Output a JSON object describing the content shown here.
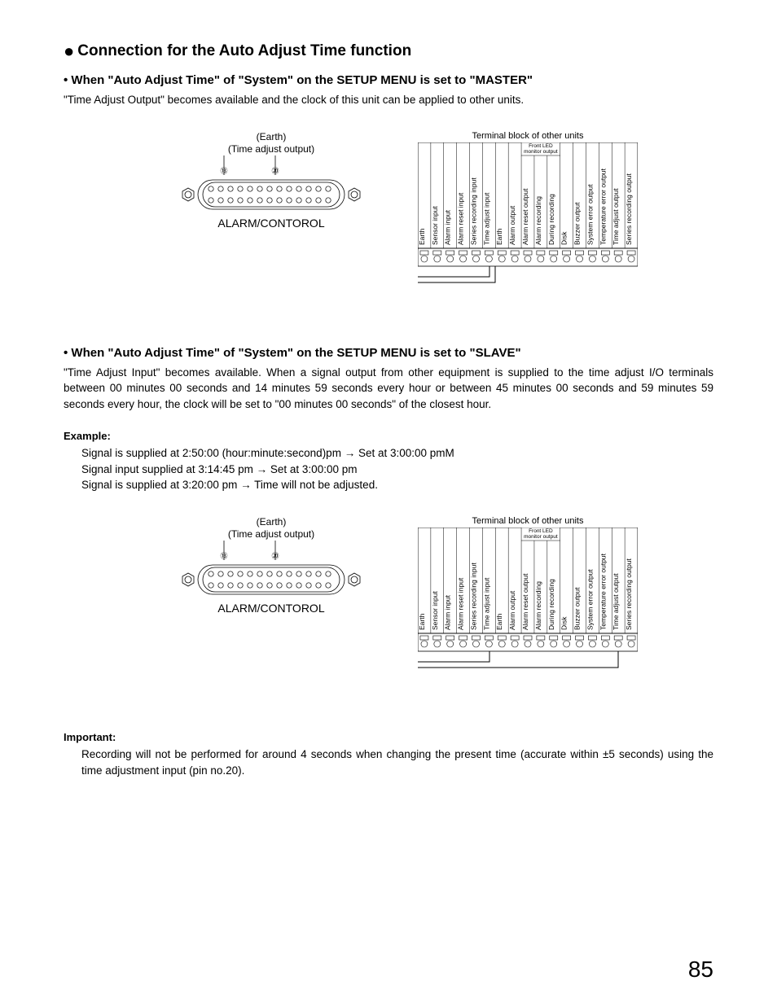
{
  "section_title": "Connection for the Auto Adjust Time function",
  "master": {
    "heading": "• When \"Auto Adjust Time\" of \"System\" on the SETUP MENU is set to \"MASTER\"",
    "body": "\"Time Adjust Output\" becomes available and the clock of this unit can be applied to other units."
  },
  "slave": {
    "heading": "• When \"Auto Adjust Time\" of \"System\" on the SETUP MENU is set to \"SLAVE\"",
    "body": "\"Time Adjust Input\" becomes available. When a signal output from other equipment is supplied to the time adjust I/O terminals between 00 minutes 00 seconds and 14 minutes 59 seconds every hour or between 45 minutes 00 seconds and 59 minutes 59 seconds every hour, the clock will be set to \"00 minutes 00 seconds\" of the closest hour."
  },
  "example": {
    "label": "Example:",
    "line1": "Signal is supplied at 2:50:00 (hour:minute:second)pm → Set at 3:00:00 pmM",
    "line2": "Signal input supplied at 3:14:45 pm → Set at 3:00:00 pm",
    "line3": "Signal is supplied at 3:20:00 pm → Time will not be adjusted."
  },
  "important": {
    "label": "Important:",
    "body": "Recording will not be performed for around 4 seconds when changing the present time (accurate within ±5 seconds) using the time adjustment input (pin no.20)."
  },
  "diagram": {
    "earth_label": "(Earth)",
    "time_adjust_label": "(Time adjust output)",
    "pin13": "13",
    "pin20": "20",
    "alarm_control": "ALARM/CONTOROL",
    "terminal_block_header": "Terminal block of other units",
    "front_led": "Front LED monitor output",
    "terminal_labels": [
      "Earth",
      "Sensor input",
      "Alarm input",
      "Alarm reset input",
      "Series recording input",
      "Time adjust input",
      "Earth",
      "Alarm output",
      "Alarm reset output",
      "Alarm recording",
      "During recording",
      "Disk",
      "Buzzer output",
      "System error output",
      "Temperature error output",
      "Time adjust output",
      "Series recording output"
    ]
  },
  "page_number": "85"
}
